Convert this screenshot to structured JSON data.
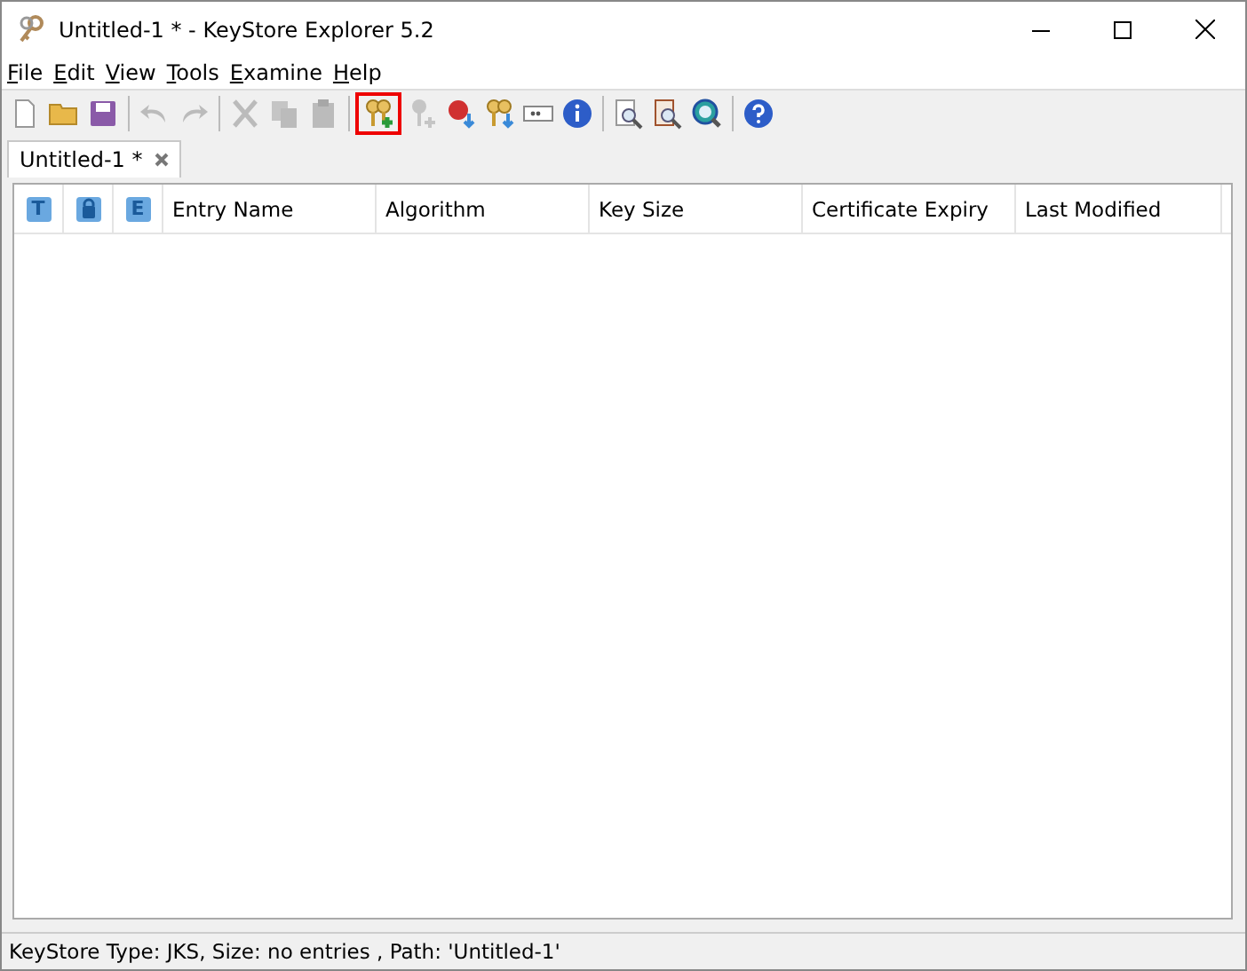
{
  "window": {
    "title": "Untitled-1 * - KeyStore Explorer 5.2"
  },
  "menu": [
    "File",
    "Edit",
    "View",
    "Tools",
    "Examine",
    "Help"
  ],
  "toolbar": [
    {
      "kind": "new",
      "disabled": false,
      "highlighted": false
    },
    {
      "kind": "open",
      "disabled": false,
      "highlighted": false
    },
    {
      "kind": "save",
      "disabled": false,
      "highlighted": false
    },
    {
      "kind": "separator"
    },
    {
      "kind": "undo",
      "disabled": true,
      "highlighted": false
    },
    {
      "kind": "redo",
      "disabled": true,
      "highlighted": false
    },
    {
      "kind": "separator"
    },
    {
      "kind": "cut",
      "disabled": true,
      "highlighted": false
    },
    {
      "kind": "copy",
      "disabled": true,
      "highlighted": false
    },
    {
      "kind": "paste",
      "disabled": true,
      "highlighted": false
    },
    {
      "kind": "separator"
    },
    {
      "kind": "keypair",
      "disabled": false,
      "highlighted": true
    },
    {
      "kind": "key",
      "disabled": true,
      "highlighted": false
    },
    {
      "kind": "seal",
      "disabled": false,
      "highlighted": false
    },
    {
      "kind": "keys",
      "disabled": false,
      "highlighted": false
    },
    {
      "kind": "password",
      "disabled": false,
      "highlighted": false
    },
    {
      "kind": "info",
      "disabled": false,
      "highlighted": false
    },
    {
      "kind": "separator"
    },
    {
      "kind": "examine-file",
      "disabled": false,
      "highlighted": false
    },
    {
      "kind": "examine-clipboard",
      "disabled": false,
      "highlighted": false
    },
    {
      "kind": "examine-ssl",
      "disabled": false,
      "highlighted": false
    },
    {
      "kind": "separator"
    },
    {
      "kind": "help",
      "disabled": false,
      "highlighted": false
    }
  ],
  "tabs": [
    {
      "label": "Untitled-1 *",
      "selected": true
    }
  ],
  "table": {
    "columns": [
      {
        "kind": "letter",
        "label": "T"
      },
      {
        "kind": "lock"
      },
      {
        "kind": "letter",
        "label": "E"
      },
      {
        "kind": "text",
        "label": "Entry Name"
      },
      {
        "kind": "text",
        "label": "Algorithm"
      },
      {
        "kind": "text",
        "label": "Key Size"
      },
      {
        "kind": "text",
        "label": "Certificate Expiry"
      },
      {
        "kind": "text",
        "label": "Last Modified"
      }
    ]
  },
  "status_bar": "KeyStore Type: JKS, Size: no entries , Path: 'Untitled-1'"
}
